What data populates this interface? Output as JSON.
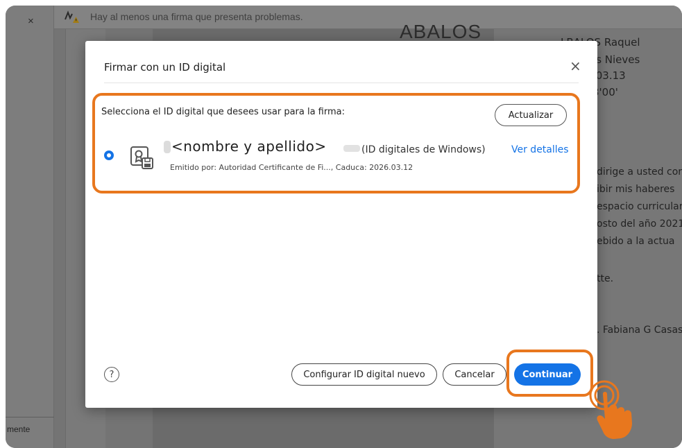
{
  "background": {
    "close_glyph": "×",
    "signature_warning": "Hay al menos una firma que presenta problemas.",
    "left_panel_bottom_text": "mente",
    "doc_heading": "ABALOS",
    "right_lines": {
      "l1": "LBALOS Raquel",
      "l2": "as Nieves",
      "l3": ".03.13",
      "l4": "3'00'",
      "p1": "dirige a usted cor",
      "p2": "ibir mis haberes",
      "p3": "espacio curricular",
      "p4": "osto del año 2021",
      "p5": "ebido a la actua",
      "p6": "tte.",
      "p7": ". Fabiana G Casas"
    }
  },
  "dialog": {
    "title": "Firmar con un ID digital",
    "close_glyph": "×",
    "prompt": "Selecciona el ID digital que desees usar para la firma:",
    "update_button": "Actualizar",
    "certificate": {
      "name": "<nombre y apellido>",
      "type": "(ID digitales de Windows)",
      "details_link": "Ver detalles",
      "issuer": "Emitido por: Autoridad Certificante de Fi..., Caduca: 2026.03.12",
      "selected": true,
      "icon": "certificate-icon"
    },
    "help_glyph": "?",
    "buttons": {
      "configure": "Configurar ID digital nuevo",
      "cancel": "Cancelar",
      "continue": "Continuar"
    }
  },
  "colors": {
    "accent": "#1473e6",
    "highlight": "#e8771e",
    "warning": "#f0b400"
  }
}
